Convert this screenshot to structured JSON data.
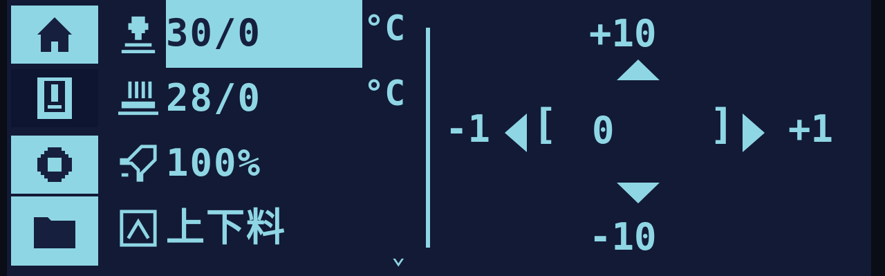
{
  "sidebar": {
    "items": [
      {
        "icon": "home-icon"
      },
      {
        "icon": "print-icon"
      },
      {
        "icon": "gear-icon"
      },
      {
        "icon": "folder-icon"
      }
    ]
  },
  "status": {
    "nozzle": {
      "icon": "nozzle-icon",
      "value": "30/0",
      "unit": "°C"
    },
    "bed": {
      "icon": "bed-icon",
      "value": "28/0",
      "unit": "°C"
    },
    "speed": {
      "icon": "speed-icon",
      "value": "100%"
    },
    "filament": {
      "icon": "filament-icon",
      "label": "上下料"
    },
    "scroll_indicator": "⌄"
  },
  "jog": {
    "up_label": "+10",
    "down_label": "-10",
    "left_label": "-1",
    "right_label": "+1",
    "value": "0"
  },
  "colors": {
    "accent": "#8fd6e4",
    "background": "#121a36",
    "text_on_accent": "#16203e"
  }
}
